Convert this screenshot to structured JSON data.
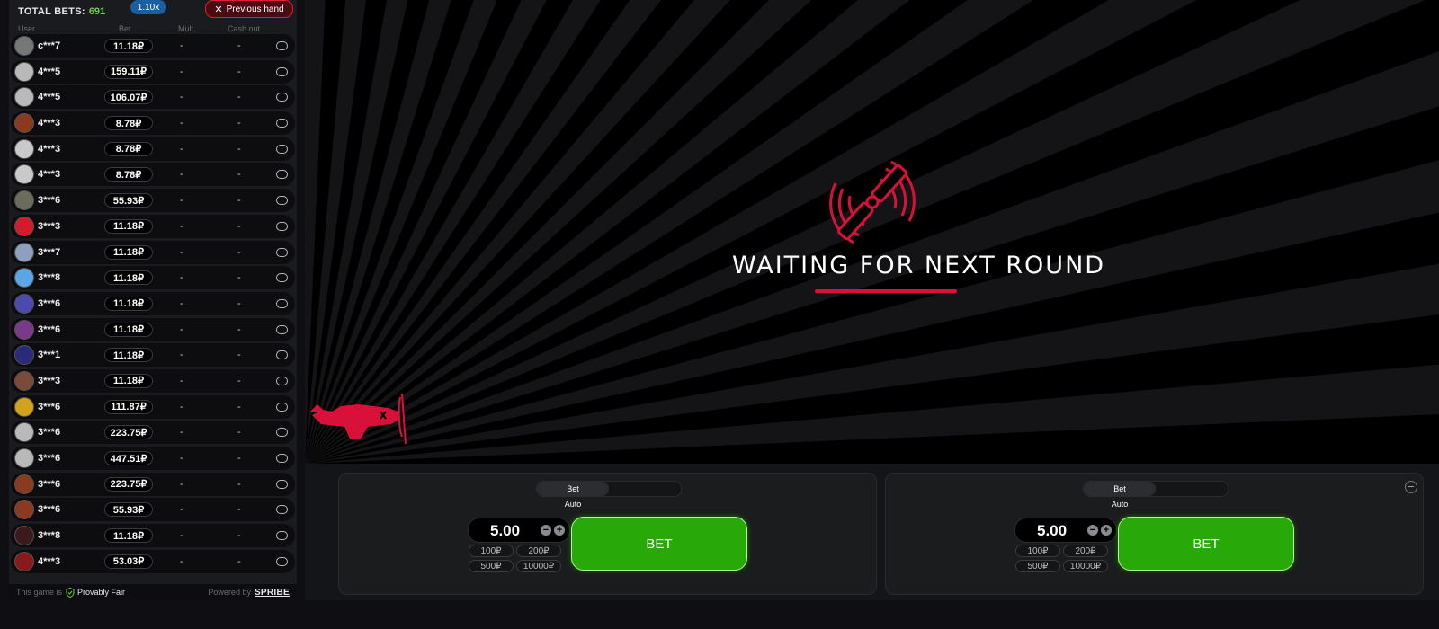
{
  "header": {
    "total_bets_label": "TOTAL BETS:",
    "total_bets_count": "691",
    "multiplier": "1.10x",
    "previous_hand": "Previous hand"
  },
  "columns": {
    "user": "User",
    "bet": "Bet",
    "mult": "Mult.",
    "cashout": "Cash out"
  },
  "bets": [
    {
      "user": "c***7",
      "bet": "11.18₽",
      "mult": "-",
      "cashout": "-",
      "avatar": "#777"
    },
    {
      "user": "4***5",
      "bet": "159.11₽",
      "mult": "-",
      "cashout": "-",
      "avatar": "#b9b9b9"
    },
    {
      "user": "4***5",
      "bet": "106.07₽",
      "mult": "-",
      "cashout": "-",
      "avatar": "#b9b9b9"
    },
    {
      "user": "4***3",
      "bet": "8.78₽",
      "mult": "-",
      "cashout": "-",
      "avatar": "#8a3a1e"
    },
    {
      "user": "4***3",
      "bet": "8.78₽",
      "mult": "-",
      "cashout": "-",
      "avatar": "#c9c9c9"
    },
    {
      "user": "4***3",
      "bet": "8.78₽",
      "mult": "-",
      "cashout": "-",
      "avatar": "#c9c9c9"
    },
    {
      "user": "3***6",
      "bet": "55.93₽",
      "mult": "-",
      "cashout": "-",
      "avatar": "#6c6c5a"
    },
    {
      "user": "3***3",
      "bet": "11.18₽",
      "mult": "-",
      "cashout": "-",
      "avatar": "#d21c2a"
    },
    {
      "user": "3***7",
      "bet": "11.18₽",
      "mult": "-",
      "cashout": "-",
      "avatar": "#8ea0c0"
    },
    {
      "user": "3***8",
      "bet": "11.18₽",
      "mult": "-",
      "cashout": "-",
      "avatar": "#5aa6e6"
    },
    {
      "user": "3***6",
      "bet": "11.18₽",
      "mult": "-",
      "cashout": "-",
      "avatar": "#4a4ab0"
    },
    {
      "user": "3***6",
      "bet": "11.18₽",
      "mult": "-",
      "cashout": "-",
      "avatar": "#7a3a8a"
    },
    {
      "user": "3***1",
      "bet": "11.18₽",
      "mult": "-",
      "cashout": "-",
      "avatar": "#2a2a7a"
    },
    {
      "user": "3***3",
      "bet": "11.18₽",
      "mult": "-",
      "cashout": "-",
      "avatar": "#7a4a3a"
    },
    {
      "user": "3***6",
      "bet": "111.87₽",
      "mult": "-",
      "cashout": "-",
      "avatar": "#d2a21a"
    },
    {
      "user": "3***6",
      "bet": "223.75₽",
      "mult": "-",
      "cashout": "-",
      "avatar": "#b9b9b9"
    },
    {
      "user": "3***6",
      "bet": "447.51₽",
      "mult": "-",
      "cashout": "-",
      "avatar": "#b9b9b9"
    },
    {
      "user": "3***6",
      "bet": "223.75₽",
      "mult": "-",
      "cashout": "-",
      "avatar": "#8a3a1e"
    },
    {
      "user": "3***6",
      "bet": "55.93₽",
      "mult": "-",
      "cashout": "-",
      "avatar": "#8a3a1e"
    },
    {
      "user": "3***8",
      "bet": "11.18₽",
      "mult": "-",
      "cashout": "-",
      "avatar": "#3a1a1a"
    },
    {
      "user": "4***3",
      "bet": "53.03₽",
      "mult": "-",
      "cashout": "-",
      "avatar": "#8a1a1a"
    }
  ],
  "footer": {
    "this_game_is": "This game is",
    "provably_fair": "Provably Fair",
    "powered_by": "Powered by",
    "brand": "SPRIBE"
  },
  "stage": {
    "waiting_text": "WAITING FOR NEXT ROUND"
  },
  "panels": [
    {
      "tab_bet": "Bet",
      "tab_auto": "Auto",
      "amount": "5.00",
      "quick": [
        "100₽",
        "200₽",
        "500₽",
        "10000₽"
      ],
      "bet_label": "BET"
    },
    {
      "tab_bet": "Bet",
      "tab_auto": "Auto",
      "amount": "5.00",
      "quick": [
        "100₽",
        "200₽",
        "500₽",
        "10000₽"
      ],
      "bet_label": "BET"
    }
  ],
  "colors": {
    "accent": "#d9113a",
    "bet_green": "#28a909",
    "count_green": "#6bd14b",
    "badge_blue": "#1a5ea4"
  }
}
